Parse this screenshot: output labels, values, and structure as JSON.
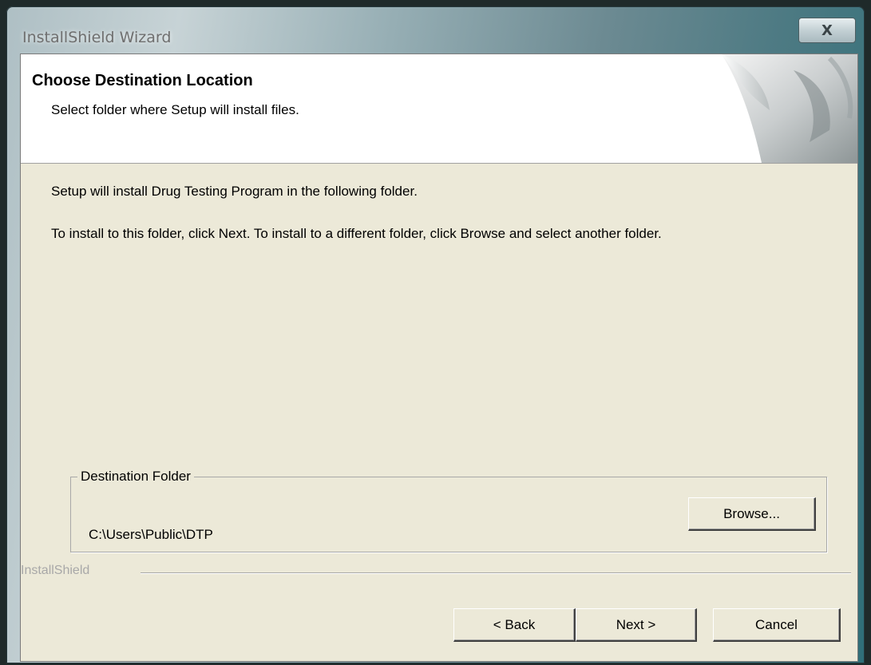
{
  "window": {
    "title": "InstallShield Wizard",
    "close_icon": "close-x-icon",
    "close_glyph": "X"
  },
  "header": {
    "title": "Choose Destination Location",
    "subtitle": "Select folder where Setup will install files.",
    "art_icon": "page-curl-graphic"
  },
  "body": {
    "line1": "Setup will install Drug Testing Program in the following folder.",
    "line2": "To install to this folder, click Next. To install to a different folder, click Browse and select another folder."
  },
  "destination": {
    "label": "Destination Folder",
    "path": "C:\\Users\\Public\\DTP",
    "browse_label": "Browse..."
  },
  "footer": {
    "brand": "InstallShield",
    "back_label": "< Back",
    "next_label": "Next >",
    "cancel_label": "Cancel"
  }
}
